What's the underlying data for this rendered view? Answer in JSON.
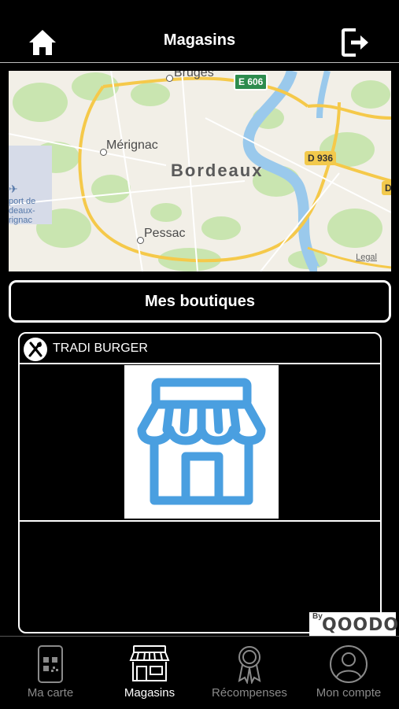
{
  "header": {
    "title": "Magasins"
  },
  "map": {
    "labels": {
      "bruges": "Bruges",
      "merignac": "Mérignac",
      "bordeaux": "Bordeaux",
      "pessac": "Pessac",
      "airport": "port de\ndeaux-\nrignac"
    },
    "roads": {
      "e606": "E 606",
      "d936": "D 936",
      "d_edge": "D"
    },
    "legal": "Legal"
  },
  "shops_button": "Mes boutiques",
  "shop": {
    "name": "TRADI BURGER"
  },
  "brand": {
    "by": "By",
    "name": "QOODOS"
  },
  "tabs": [
    {
      "label": "Ma carte"
    },
    {
      "label": "Magasins"
    },
    {
      "label": "Récompenses"
    },
    {
      "label": "Mon compte"
    }
  ],
  "colors": {
    "background": "#000000",
    "accent": "#ffffff",
    "store_icon": "#4a9fe0",
    "tab_inactive": "#8a8a8a"
  }
}
